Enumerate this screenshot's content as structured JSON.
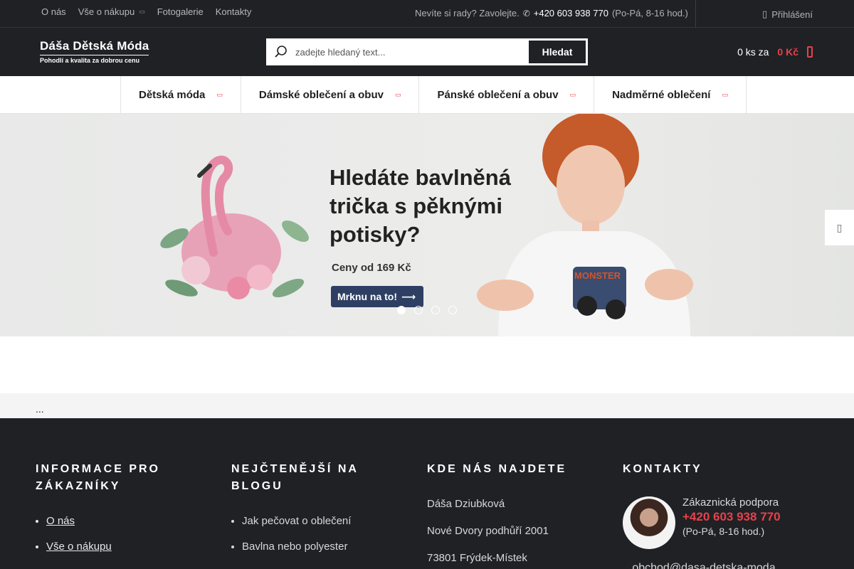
{
  "topbar": {
    "nav": [
      {
        "label": "O nás",
        "dropdown": false
      },
      {
        "label": "Vše o nákupu",
        "dropdown": true
      },
      {
        "label": "Fotogalerie",
        "dropdown": false
      },
      {
        "label": "Kontakty",
        "dropdown": false
      }
    ],
    "help_text": "Nevíte si rady? Zavolejte.",
    "phone": "+420 603 938 770",
    "hours": "(Po-Pá, 8-16 hod.)",
    "login_label": "Přihlášení"
  },
  "header": {
    "logo_title": "Dáša Dětská Móda",
    "logo_tagline": "Pohodlí a kvalita za dobrou cenu",
    "search_placeholder": "zadejte hledaný text...",
    "search_button": "Hledat",
    "cart_count": "0 ks za",
    "cart_price": "0 Kč"
  },
  "categories": [
    "Dětská móda",
    "Dámské oblečení a obuv",
    "Pánské oblečení a obuv",
    "Nadměrné oblečení"
  ],
  "banner": {
    "headline_lines": [
      "Hledáte bavlněná",
      "trička s pěknými",
      "potisky?"
    ],
    "price_text": "Ceny od 169 Kč",
    "cta": "Mrknu na to!",
    "slides": 4,
    "active_slide": 1,
    "shirt_print": "MONSTER"
  },
  "crumbs": "...",
  "footer": {
    "col1": {
      "title": "INFORMACE PRO ZÁKAZNÍKY",
      "items": [
        "O nás",
        "Vše o nákupu"
      ]
    },
    "col2": {
      "title": "NEJČTENĚJŠÍ NA BLOGU",
      "items": [
        "Jak pečovat o oblečení",
        "Bavlna nebo polyester"
      ]
    },
    "col3": {
      "title": "KDE NÁS NAJDETE",
      "lines": [
        "Dáša Dziubková",
        "Nové Dvory podhůří 2001",
        "73801 Frýdek-Místek"
      ]
    },
    "col4": {
      "title": "KONTAKTY",
      "support_label": "Zákaznická podpora",
      "phone": "+420 603 938 770",
      "hours": "(Po-Pá, 8-16 hod.)",
      "email_fragment": "...obchod@dasa-detska-moda..."
    }
  },
  "colors": {
    "dark": "#1f2125",
    "accent": "#e8414a",
    "cta": "#2e3f63"
  }
}
